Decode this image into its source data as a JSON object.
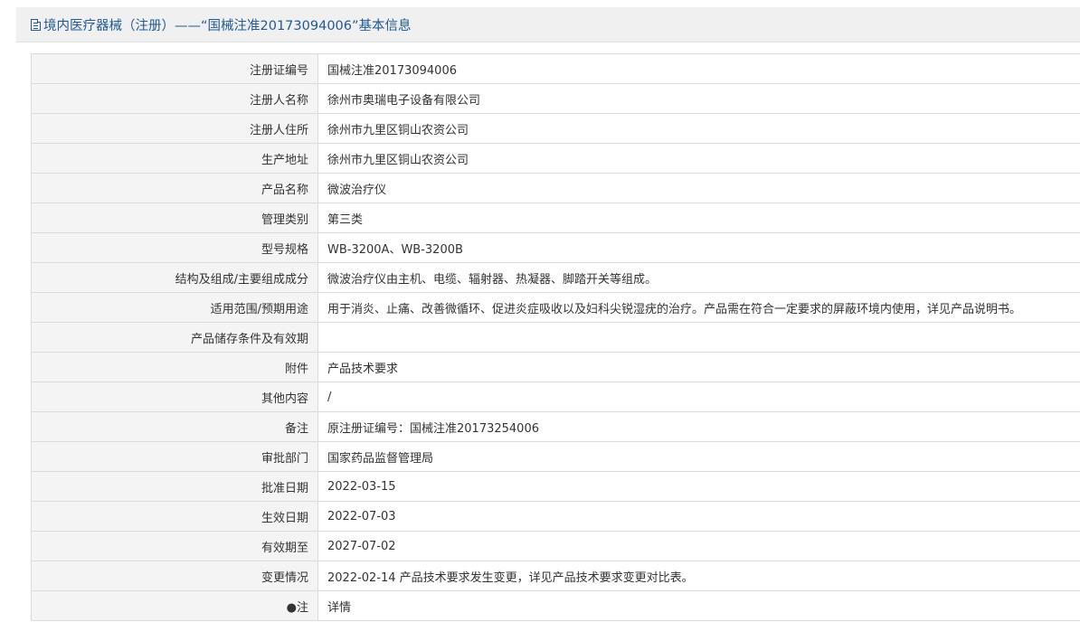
{
  "header": {
    "title": "境内医疗器械（注册）——“国械注准20173094006”基本信息",
    "icon": "document-icon"
  },
  "rows": [
    {
      "label": "注册证编号",
      "value": "国械注准20173094006"
    },
    {
      "label": "注册人名称",
      "value": "徐州市奥瑞电子设备有限公司"
    },
    {
      "label": "注册人住所",
      "value": "徐州市九里区铜山农资公司"
    },
    {
      "label": "生产地址",
      "value": "徐州市九里区铜山农资公司"
    },
    {
      "label": "产品名称",
      "value": "微波治疗仪"
    },
    {
      "label": "管理类别",
      "value": "第三类"
    },
    {
      "label": "型号规格",
      "value": "WB-3200A、WB-3200B"
    },
    {
      "label": "结构及组成/主要组成成分",
      "value": "微波治疗仪由主机、电缆、辐射器、热凝器、脚踏开关等组成。"
    },
    {
      "label": "适用范围/预期用途",
      "value": "用于消炎、止痛、改善微循环、促进炎症吸收以及妇科尖锐湿疣的治疗。产品需在符合一定要求的屏蔽环境内使用，详见产品说明书。"
    },
    {
      "label": "产品储存条件及有效期",
      "value": ""
    },
    {
      "label": "附件",
      "value": "产品技术要求"
    },
    {
      "label": "其他内容",
      "value": "/"
    },
    {
      "label": "备注",
      "value": "原注册证编号：国械注准20173254006"
    },
    {
      "label": "审批部门",
      "value": "国家药品监督管理局"
    },
    {
      "label": "批准日期",
      "value": "2022-03-15"
    },
    {
      "label": "生效日期",
      "value": "2022-07-03"
    },
    {
      "label": "有效期至",
      "value": "2027-07-02"
    },
    {
      "label": "变更情况",
      "value": "2022-02-14 产品技术要求发生变更，详见产品技术要求变更对比表。"
    },
    {
      "label": "●注",
      "value": "详情"
    }
  ]
}
